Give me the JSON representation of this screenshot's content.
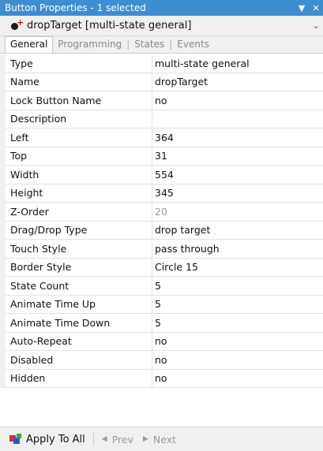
{
  "titlebar": {
    "title": "Button Properties - 1 selected",
    "pin_icon": "pin-dropdown-icon",
    "close_icon": "close-icon"
  },
  "selector": {
    "text": "dropTarget  [multi-state general]",
    "icon": "object-dot-icon",
    "chevron": "chevron-down-icon"
  },
  "tabs": [
    {
      "label": "General",
      "active": true
    },
    {
      "label": "Programming",
      "active": false
    },
    {
      "label": "States",
      "active": false
    },
    {
      "label": "Events",
      "active": false
    }
  ],
  "properties": [
    {
      "label": "Type",
      "value": "multi-state general"
    },
    {
      "label": "Name",
      "value": "dropTarget"
    },
    {
      "label": "Lock Button Name",
      "value": "no"
    },
    {
      "label": "Description",
      "value": ""
    },
    {
      "label": "Left",
      "value": "364"
    },
    {
      "label": "Top",
      "value": "31"
    },
    {
      "label": "Width",
      "value": "554"
    },
    {
      "label": "Height",
      "value": "345"
    },
    {
      "label": "Z-Order",
      "value": "20"
    },
    {
      "label": "Drag/Drop Type",
      "value": "drop target"
    },
    {
      "label": "Touch Style",
      "value": "pass through"
    },
    {
      "label": "Border Style",
      "value": "Circle 15"
    },
    {
      "label": "State Count",
      "value": "5"
    },
    {
      "label": "Animate Time Up",
      "value": "5"
    },
    {
      "label": "Animate Time Down",
      "value": "5"
    },
    {
      "label": "Auto-Repeat",
      "value": "no"
    },
    {
      "label": "Disabled",
      "value": "no"
    },
    {
      "label": "Hidden",
      "value": "no"
    }
  ],
  "bottombar": {
    "apply_label": "Apply To All",
    "prev_label": "Prev",
    "next_label": "Next"
  },
  "colors": {
    "titlebar_bg": "#3d8ed1",
    "panel_bg": "#f0f0f0",
    "dim_text": "#9a9a9a"
  }
}
